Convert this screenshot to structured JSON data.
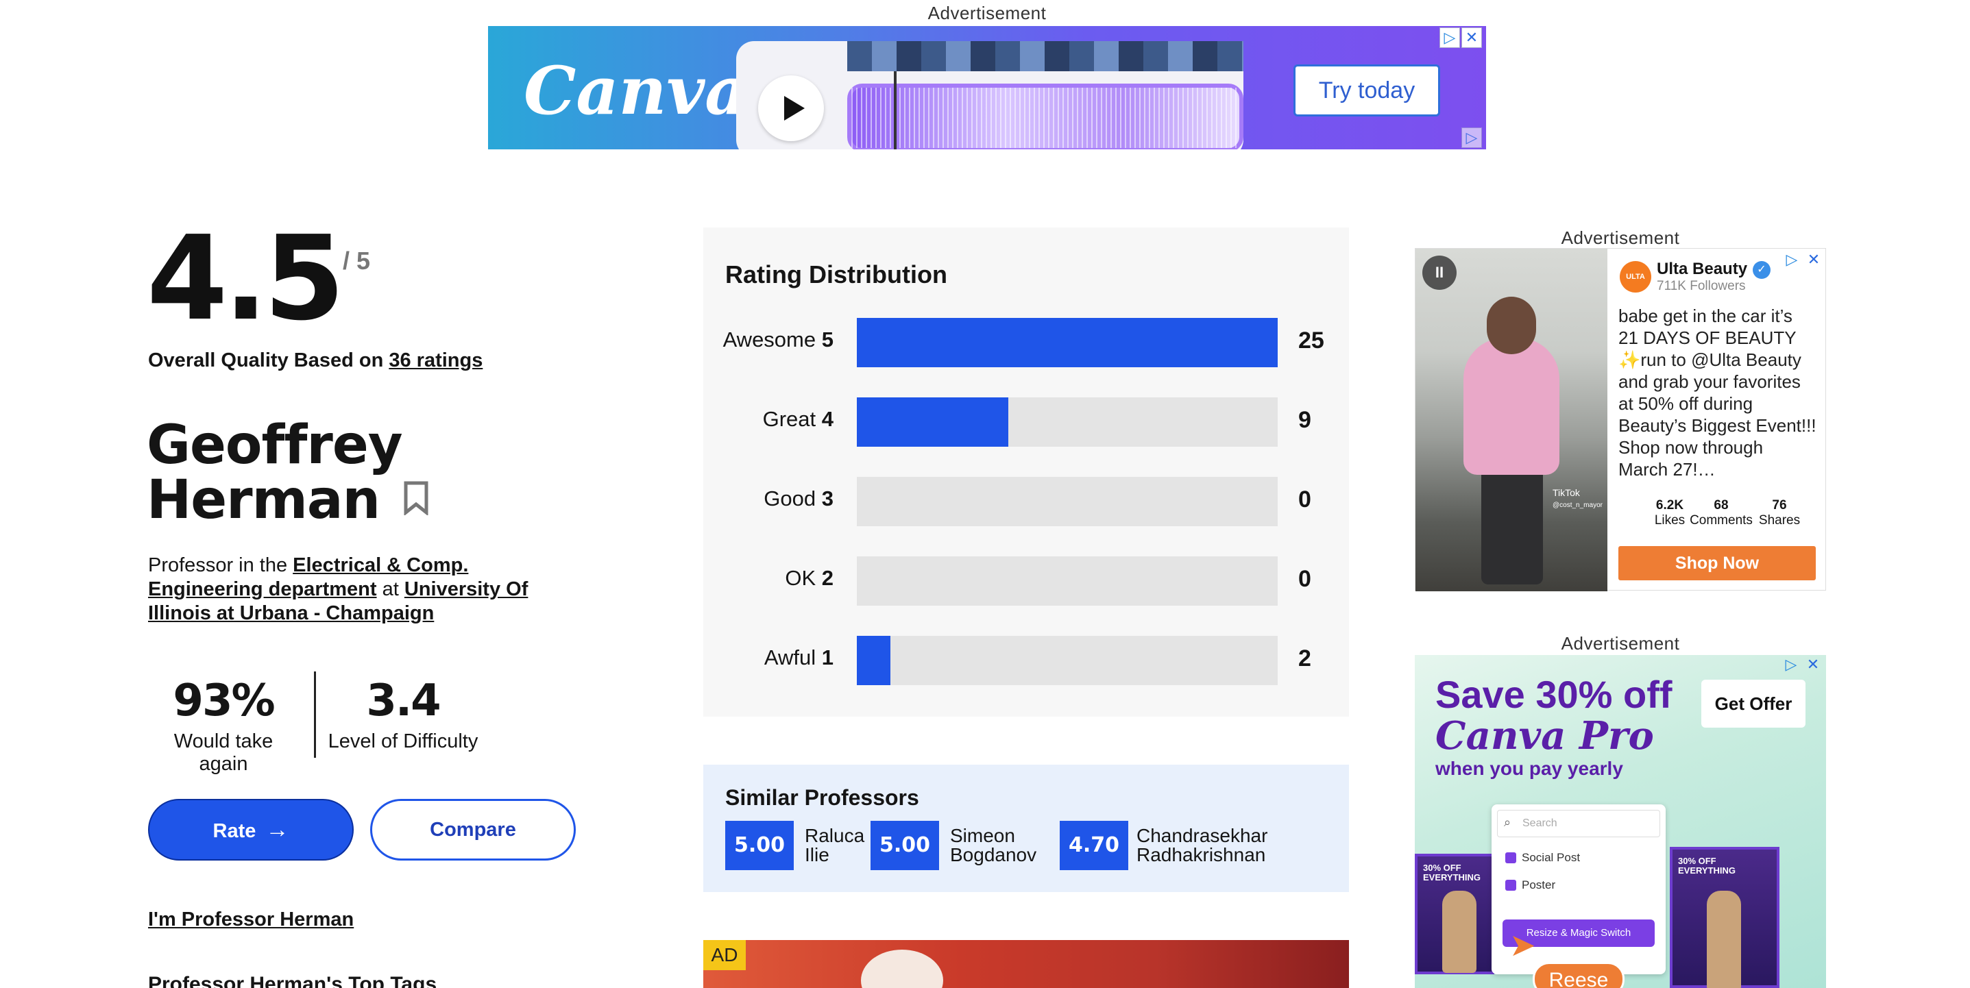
{
  "top_ad": {
    "label": "Advertisement",
    "brand": "Canva",
    "cta": "Try today"
  },
  "rating": {
    "score": "4.5",
    "out_of": "/ 5",
    "overall_prefix": "Overall Quality Based on ",
    "ratings_link": "36 ratings"
  },
  "professor": {
    "first_name": "Geoffrey",
    "last_name": "Herman",
    "dept_prefix": "Professor in the ",
    "department": "Electrical & Comp. Engineering department",
    "at": " at ",
    "university": "University Of Illinois at Urbana - Champaign"
  },
  "stats": {
    "take_again_value": "93%",
    "take_again_label": "Would take again",
    "difficulty_value": "3.4",
    "difficulty_label": "Level of Difficulty"
  },
  "actions": {
    "rate": "Rate",
    "compare": "Compare",
    "im_professor": "I'm Professor Herman",
    "top_tags": "Professor Herman's Top Tags"
  },
  "distribution": {
    "title": "Rating Distribution",
    "max": 25,
    "rows": [
      {
        "label": "Awesome",
        "num": "5",
        "count": 25
      },
      {
        "label": "Great",
        "num": "4",
        "count": 9
      },
      {
        "label": "Good",
        "num": "3",
        "count": 0
      },
      {
        "label": "OK",
        "num": "2",
        "count": 0
      },
      {
        "label": "Awful",
        "num": "1",
        "count": 2
      }
    ]
  },
  "similar": {
    "title": "Similar Professors",
    "professors": [
      {
        "score": "5.00",
        "first": "Raluca",
        "last": "Ilie"
      },
      {
        "score": "5.00",
        "first": "Simeon",
        "last": "Bogdanov"
      },
      {
        "score": "4.70",
        "first": "Chandrasekhar",
        "last": "Radhakrishnan"
      }
    ]
  },
  "bottom_ad": {
    "badge": "AD"
  },
  "ulta_ad": {
    "label": "Advertisement",
    "name": "Ulta Beauty",
    "avatar_text": "ULTA",
    "followers": "711K Followers",
    "text": "babe get in the car it’s 21 DAYS OF BEAUTY ✨run to @Ulta Beauty and grab your favorites at 50% off during Beauty’s Biggest Event!!! Shop now through March 27!…",
    "likes_value": "6.2K",
    "likes_label": "Likes",
    "comments_value": "68",
    "comments_label": "Comments",
    "shares_value": "76",
    "shares_label": "Shares",
    "cta": "Shop Now",
    "watermark": "TikTok",
    "watermark_handle": "@cost_n_mayor"
  },
  "canva_pro_ad": {
    "label": "Advertisement",
    "headline": "Save 30% off",
    "product": "Canva Pro",
    "subline": "when you pay yearly",
    "cta": "Get Offer",
    "search_placeholder": "Search",
    "option1": "Social Post",
    "option2": "Poster",
    "magic": "Resize & Magic Switch",
    "poster_text": "30% OFF EVERYTHING",
    "cursor_label": "Reese"
  }
}
